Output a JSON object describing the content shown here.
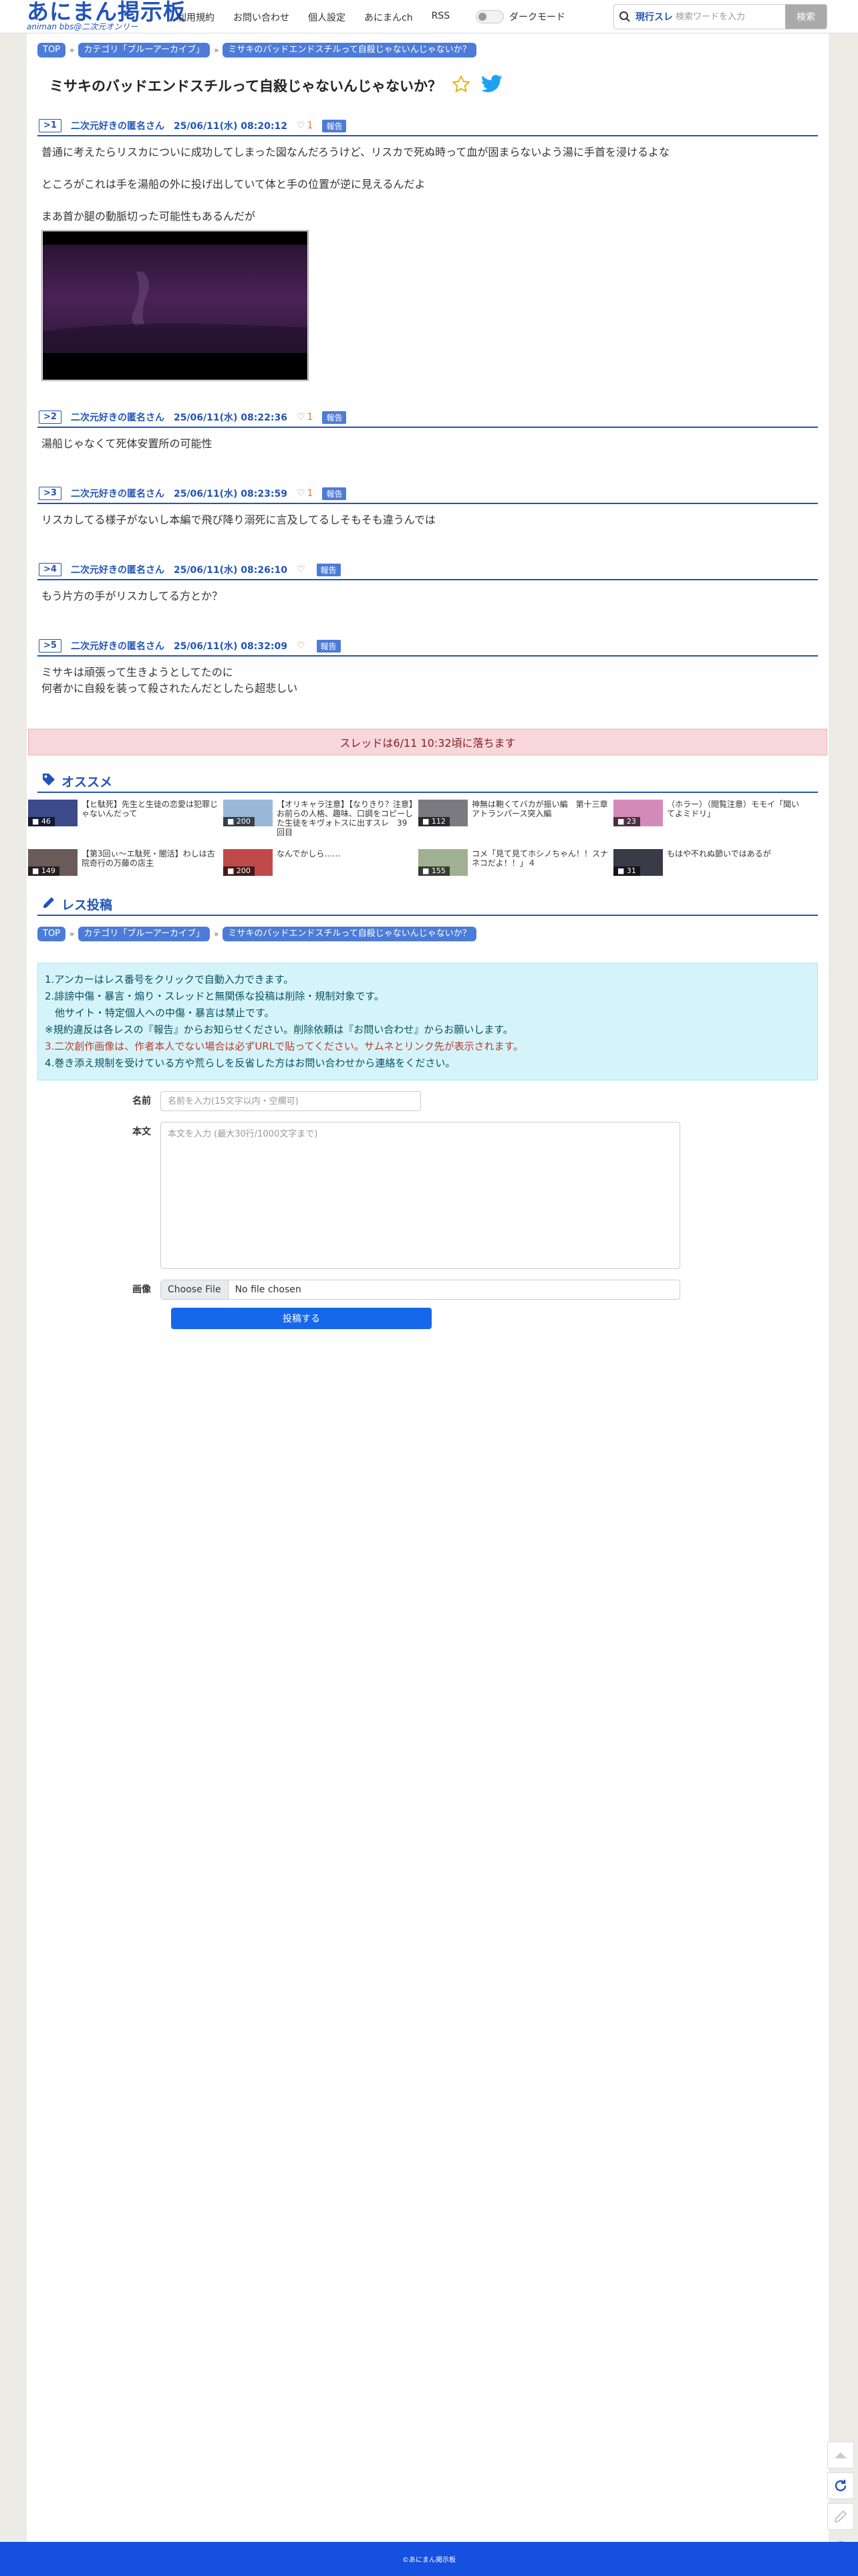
{
  "header": {
    "logo_main": "あにまん掲示板",
    "logo_sub": "animan bbs@二次元オンリー",
    "nav": [
      "利用規約",
      "お問い合わせ",
      "個人設定",
      "あにまんch",
      "RSS"
    ],
    "dark_mode_label": "ダークモード",
    "search_scope": "現行スレ",
    "search_placeholder": "検索ワードを入力",
    "search_button": "検索"
  },
  "breadcrumb": [
    "TOP",
    "カテゴリ「ブルーアーカイブ」",
    "ミサキのバッドエンドスチルって自殺じゃないんじゃないか？"
  ],
  "thread": {
    "title": "ミサキのバッドエンドスチルって自殺じゃないんじゃないか？"
  },
  "posts": [
    {
      "num": ">1",
      "name": "二次元好きの匿名さん",
      "date": "25/06/11(水) 08:20:12",
      "likes": "1",
      "report": "報告",
      "lines": [
        "普通に考えたらリスカについに成功してしまった図なんだろうけど、リスカで死ぬ時って血が固まらないよう湯に手首を浸けるよな",
        "",
        "ところがこれは手を湯船の外に投げ出していて体と手の位置が逆に見えるんだよ",
        "",
        "まあ首か腿の動脈切った可能性もあるんだが"
      ],
      "has_image": true
    },
    {
      "num": ">2",
      "name": "二次元好きの匿名さん",
      "date": "25/06/11(水) 08:22:36",
      "likes": "1",
      "report": "報告",
      "lines": [
        "湯船じゃなくて死体安置所の可能性"
      ],
      "has_image": false
    },
    {
      "num": ">3",
      "name": "二次元好きの匿名さん",
      "date": "25/06/11(水) 08:23:59",
      "likes": "1",
      "report": "報告",
      "lines": [
        "リスカしてる様子がないし本編で飛び降り溺死に言及してるしそもそも違うんでは"
      ],
      "has_image": false
    },
    {
      "num": ">4",
      "name": "二次元好きの匿名さん",
      "date": "25/06/11(水) 08:26:10",
      "likes": "",
      "report": "報告",
      "lines": [
        "もう片方の手がリスカしてる方とか？"
      ],
      "has_image": false
    },
    {
      "num": ">5",
      "name": "二次元好きの匿名さん",
      "date": "25/06/11(水) 08:32:09",
      "likes": "",
      "report": "報告",
      "lines": [
        "ミサキは頑張って生きようとしてたのに",
        "何者かに自殺を装って殺されたんだとしたら超悲しい"
      ],
      "has_image": false
    }
  ],
  "notice": "スレッドは6/11 10:32頃に落ちます",
  "recommend": {
    "title": "オススメ",
    "items": [
      {
        "count": "46",
        "title": "【ヒ駄死】先生と生徒の恋愛は犯罪じゃないんだって",
        "color": "#3a4a8a"
      },
      {
        "count": "200",
        "title": "【オリキャラ注意】【なりきり？注意】お前らの人格、趣味、口調をコピーした生徒をキヴォトスに出すスレ　39回目",
        "color": "#9ab8d8"
      },
      {
        "count": "112",
        "title": "神無は鞄くてバカが振い編　第十三章アトランパース突入編",
        "color": "#7a7a80"
      },
      {
        "count": "23",
        "title": "（ホラー）（閲覧注意）モモイ「聞いてよミドリ」",
        "color": "#d48ab8"
      },
      {
        "count": "149",
        "title": "【第3回ぃ～エ駄死・闇活】わしは古院奇行の万藤の店主",
        "color": "#6a5a5a"
      },
      {
        "count": "200",
        "title": "なんでかしら……",
        "color": "#c04a4a"
      },
      {
        "count": "155",
        "title": "コメ「見て見てホシノちゃん！！スナネコだよ！！」４",
        "color": "#a0b090"
      },
      {
        "count": "31",
        "title": "もはや不れぬ節いではあるが",
        "color": "#3a3a48"
      }
    ]
  },
  "reply": {
    "title": "レス投稿",
    "rules": [
      "1.アンカーはレス番号をクリックで自動入力できます。",
      "2.誹謗中傷・暴言・煽り・スレッドと無関係な投稿は削除・規制対象です。",
      "　他サイト・特定個人への中傷・暴言は禁止です。",
      "※規約違反は各レスの『報告』からお知らせください。削除依頼は『お問い合わせ』からお願いします。",
      "3.二次創作画像は、作者本人でない場合は必ずURLで貼ってください。サムネとリンク先が表示されます。",
      "4.巻き添え規制を受けている方や荒らしを反省した方はお問い合わせから連絡をください。"
    ],
    "name_label": "名前",
    "name_placeholder": "名前を入力(15文字以内・空欄可)",
    "body_label": "本文",
    "body_placeholder": "本文を入力 (最大30行/1000文字まで)",
    "image_label": "画像",
    "file_button": "Choose File",
    "file_text": "No file chosen",
    "submit": "投稿する"
  },
  "footer": "©あにまん掲示板"
}
